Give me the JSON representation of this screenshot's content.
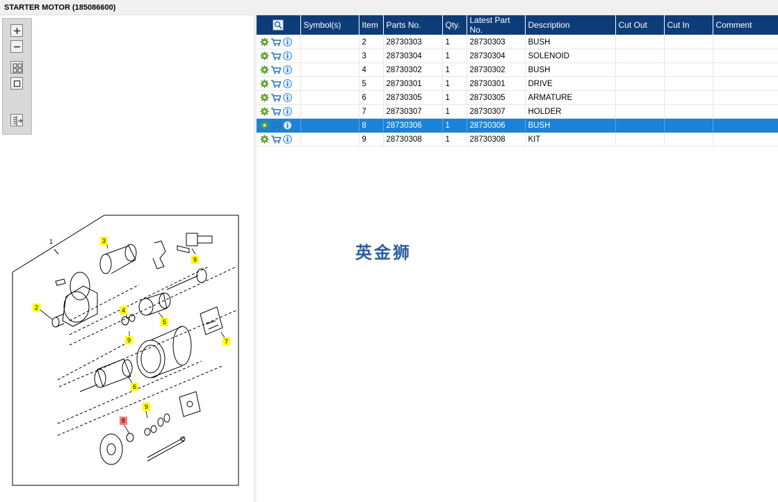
{
  "window": {
    "title": "STARTER MOTOR (185086600)"
  },
  "toolbar": {
    "buttons": [
      {
        "name": "zoom-in",
        "icon": "plus-icon"
      },
      {
        "name": "zoom-out",
        "icon": "minus-icon"
      },
      {
        "name": "fit-all",
        "icon": "fit-grid-icon"
      },
      {
        "name": "actual-size",
        "icon": "square-icon"
      },
      {
        "name": "toggle-list",
        "icon": "list-export-icon"
      }
    ]
  },
  "diagram": {
    "callouts": [
      {
        "label": "1",
        "style": "plain"
      },
      {
        "label": "3",
        "style": "yellow"
      },
      {
        "label": "9",
        "style": "yellow"
      },
      {
        "label": "2",
        "style": "yellow"
      },
      {
        "label": "4",
        "style": "yellow"
      },
      {
        "label": "5",
        "style": "yellow"
      },
      {
        "label": "9",
        "style": "yellow"
      },
      {
        "label": "7",
        "style": "yellow"
      },
      {
        "label": "6",
        "style": "yellow"
      },
      {
        "label": "8",
        "style": "red"
      },
      {
        "label": "9",
        "style": "yellow"
      }
    ]
  },
  "grid": {
    "columns": [
      "",
      "Symbol(s)",
      "Item",
      "Parts No.",
      "Qty.",
      "Latest Part No.",
      "Description",
      "Cut Out",
      "Cut In",
      "Comment"
    ],
    "rows": [
      {
        "symbols": "",
        "item": "2",
        "parts_no": "28730303",
        "qty": "1",
        "latest": "28730303",
        "desc": "BUSH",
        "cut_out": "",
        "cut_in": "",
        "comment": ""
      },
      {
        "symbols": "",
        "item": "3",
        "parts_no": "28730304",
        "qty": "1",
        "latest": "28730304",
        "desc": "SOLENOID",
        "cut_out": "",
        "cut_in": "",
        "comment": ""
      },
      {
        "symbols": "",
        "item": "4",
        "parts_no": "28730302",
        "qty": "1",
        "latest": "28730302",
        "desc": "BUSH",
        "cut_out": "",
        "cut_in": "",
        "comment": ""
      },
      {
        "symbols": "",
        "item": "5",
        "parts_no": "28730301",
        "qty": "1",
        "latest": "28730301",
        "desc": "DRIVE",
        "cut_out": "",
        "cut_in": "",
        "comment": ""
      },
      {
        "symbols": "",
        "item": "6",
        "parts_no": "28730305",
        "qty": "1",
        "latest": "28730305",
        "desc": "ARMATURE",
        "cut_out": "",
        "cut_in": "",
        "comment": ""
      },
      {
        "symbols": "",
        "item": "7",
        "parts_no": "28730307",
        "qty": "1",
        "latest": "28730307",
        "desc": "HOLDER",
        "cut_out": "",
        "cut_in": "",
        "comment": ""
      },
      {
        "symbols": "",
        "item": "8",
        "parts_no": "28730306",
        "qty": "1",
        "latest": "28730306",
        "desc": "BUSH",
        "cut_out": "",
        "cut_in": "",
        "comment": ""
      },
      {
        "symbols": "",
        "item": "9",
        "parts_no": "28730308",
        "qty": "1",
        "latest": "28730308",
        "desc": "KIT",
        "cut_out": "",
        "cut_in": "",
        "comment": ""
      }
    ],
    "selected_item": "8"
  },
  "watermark": {
    "text": "英金狮"
  },
  "colors": {
    "header_bg": "#0e3c78",
    "selected_row": "#1a82d8",
    "callout_yellow": "#ffff00",
    "callout_red": "#ff7a7a",
    "gear_green": "#5aa02c",
    "cart_blue": "#2a6fb8",
    "info_blue": "#3a8fd8"
  }
}
